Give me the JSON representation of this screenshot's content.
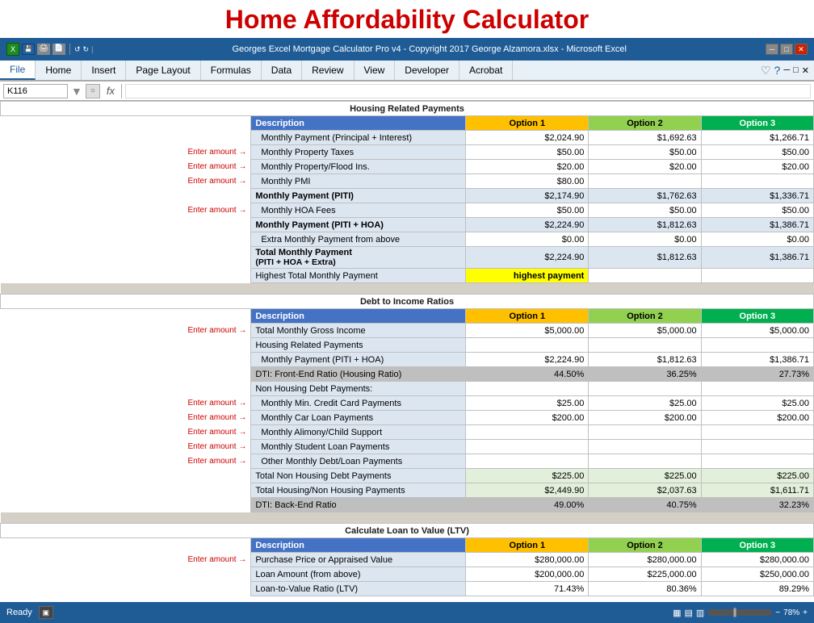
{
  "title": "Home Affordability Calculator",
  "excel": {
    "title_bar": "Georges Excel Mortgage Calculator Pro v4 - Copyright 2017 George Alzamora.xlsx  -  Microsoft Excel",
    "cell_ref": "K116",
    "fx_symbol": "fx",
    "ribbon_tabs": [
      "File",
      "Home",
      "Insert",
      "Page Layout",
      "Formulas",
      "Data",
      "Review",
      "View",
      "Developer",
      "Acrobat"
    ],
    "active_tab": "File"
  },
  "status": {
    "ready": "Ready",
    "zoom": "78%"
  },
  "sections": {
    "housing": {
      "title": "Housing Related Payments",
      "headers": {
        "description": "Description",
        "option1": "Option 1",
        "option2": "Option 2",
        "option3": "Option 3"
      },
      "rows": [
        {
          "label": "Monthly Payment (Principal + Interest)",
          "o1": "$2,024.90",
          "o2": "$1,692.63",
          "o3": "$1,266.71",
          "enter": "",
          "indent": true
        },
        {
          "label": "Monthly Property Taxes",
          "o1": "$50.00",
          "o2": "$50.00",
          "o3": "$50.00",
          "enter": "Enter amount →",
          "indent": true
        },
        {
          "label": "Monthly Property/Flood Ins.",
          "o1": "$20.00",
          "o2": "$20.00",
          "o3": "$20.00",
          "enter": "Enter amount →",
          "indent": true
        },
        {
          "label": "Monthly PMI",
          "o1": "$80.00",
          "o2": "",
          "o3": "",
          "enter": "Enter amount →",
          "indent": true
        },
        {
          "label": "Monthly Payment (PITI)",
          "o1": "$2,174.90",
          "o2": "$1,762.63",
          "o3": "$1,336.71",
          "enter": "",
          "indent": false,
          "bold": true
        },
        {
          "label": "Monthly HOA Fees",
          "o1": "$50.00",
          "o2": "$50.00",
          "o3": "$50.00",
          "enter": "Enter amount →",
          "indent": true
        },
        {
          "label": "Monthly Payment (PITI + HOA)",
          "o1": "$2,224.90",
          "o2": "$1,812.63",
          "o3": "$1,386.71",
          "enter": "",
          "indent": false,
          "bold": true
        },
        {
          "label": "Extra Monthly Payment from above",
          "o1": "$0.00",
          "o2": "$0.00",
          "o3": "$0.00",
          "enter": "",
          "indent": true
        },
        {
          "label": "Total Monthly Payment\n(PITI + HOA + Extra)",
          "o1": "$2,224.90",
          "o2": "$1,812.63",
          "o3": "$1,386.71",
          "enter": "",
          "indent": false,
          "bold": true,
          "multiline": true
        },
        {
          "label": "Highest Total Monthly Payment",
          "o1": "highest payment",
          "o2": "",
          "o3": "",
          "enter": "",
          "highlight": true
        }
      ]
    },
    "dti": {
      "title": "Debt to Income Ratios",
      "rows": [
        {
          "label": "Total Monthly Gross Income",
          "o1": "$5,000.00",
          "o2": "$5,000.00",
          "o3": "$5,000.00",
          "enter": "Enter amount →"
        },
        {
          "label": "Housing Related Payments",
          "o1": "",
          "o2": "",
          "o3": "",
          "subheader": true
        },
        {
          "label": "Monthly Payment (PITI + HOA)",
          "o1": "$2,224.90",
          "o2": "$1,812.63",
          "o3": "$1,386.71",
          "indent": true
        },
        {
          "label": "DTI: Front-End Ratio (Housing Ratio)",
          "o1": "44.50%",
          "o2": "36.25%",
          "o3": "27.73%",
          "blue": true
        },
        {
          "label": "Non Housing Debt Payments:",
          "o1": "",
          "o2": "",
          "o3": "",
          "subheader": true
        },
        {
          "label": "Monthly Min. Credit Card Payments",
          "o1": "$25.00",
          "o2": "$25.00",
          "o3": "$25.00",
          "enter": "Enter amount →",
          "indent": true
        },
        {
          "label": "Monthly Car Loan Payments",
          "o1": "$200.00",
          "o2": "$200.00",
          "o3": "$200.00",
          "enter": "Enter amount →",
          "indent": true
        },
        {
          "label": "Monthly Alimony/Child Support",
          "o1": "",
          "o2": "",
          "o3": "",
          "enter": "Enter amount →",
          "indent": true
        },
        {
          "label": "Monthly Student Loan Payments",
          "o1": "",
          "o2": "",
          "o3": "",
          "enter": "Enter amount →",
          "indent": true
        },
        {
          "label": "Other Monthly Debt/Loan Payments",
          "o1": "",
          "o2": "",
          "o3": "",
          "enter": "Enter amount →",
          "indent": true
        },
        {
          "label": "Total Non Housing Debt Payments",
          "o1": "$225.00",
          "o2": "$225.00",
          "o3": "$225.00"
        },
        {
          "label": "Total Housing/Non Housing Payments",
          "o1": "$2,449.90",
          "o2": "$2,037.63",
          "o3": "$1,611.71"
        },
        {
          "label": "DTI: Back-End Ratio",
          "o1": "49.00%",
          "o2": "40.75%",
          "o3": "32.23%",
          "blue": true
        }
      ]
    },
    "ltv": {
      "title": "Calculate Loan to Value (LTV)",
      "rows": [
        {
          "label": "Purchase Price or Appraised Value",
          "o1": "$280,000.00",
          "o2": "$280,000.00",
          "o3": "$280,000.00",
          "enter": "Enter amount →"
        },
        {
          "label": "Loan Amount (from above)",
          "o1": "$200,000.00",
          "o2": "$225,000.00",
          "o3": "$250,000.00"
        },
        {
          "label": "Loan-to-Value Ratio (LTV)",
          "o1": "71.43%",
          "o2": "80.36%",
          "o3": "89.29%"
        }
      ]
    }
  }
}
